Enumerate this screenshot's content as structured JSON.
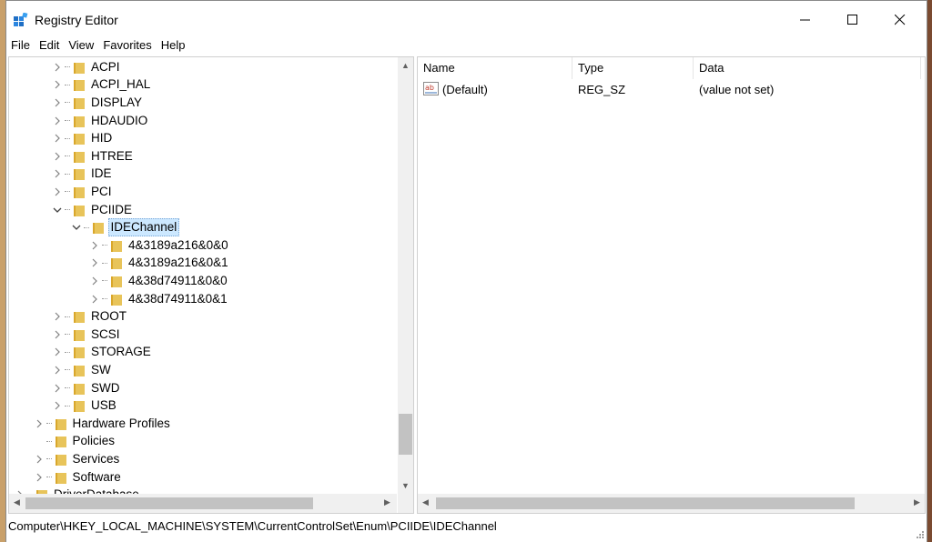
{
  "window": {
    "title": "Registry Editor",
    "controls": {
      "minimize": "—",
      "maximize": "☐",
      "close": "✕"
    }
  },
  "menu": [
    "File",
    "Edit",
    "View",
    "Favorites",
    "Help"
  ],
  "tree": {
    "nodes": [
      {
        "label": "ACPI",
        "depth": 4,
        "state": "collapsed"
      },
      {
        "label": "ACPI_HAL",
        "depth": 4,
        "state": "collapsed"
      },
      {
        "label": "DISPLAY",
        "depth": 4,
        "state": "collapsed"
      },
      {
        "label": "HDAUDIO",
        "depth": 4,
        "state": "collapsed"
      },
      {
        "label": "HID",
        "depth": 4,
        "state": "collapsed"
      },
      {
        "label": "HTREE",
        "depth": 4,
        "state": "collapsed"
      },
      {
        "label": "IDE",
        "depth": 4,
        "state": "collapsed"
      },
      {
        "label": "PCI",
        "depth": 4,
        "state": "collapsed"
      },
      {
        "label": "PCIIDE",
        "depth": 4,
        "state": "expanded"
      },
      {
        "label": "IDEChannel",
        "depth": 5,
        "state": "expanded",
        "selected": true
      },
      {
        "label": "4&3189a216&0&0",
        "depth": 6,
        "state": "collapsed"
      },
      {
        "label": "4&3189a216&0&1",
        "depth": 6,
        "state": "collapsed"
      },
      {
        "label": "4&38d74911&0&0",
        "depth": 6,
        "state": "collapsed"
      },
      {
        "label": "4&38d74911&0&1",
        "depth": 6,
        "state": "collapsed"
      },
      {
        "label": "ROOT",
        "depth": 4,
        "state": "collapsed"
      },
      {
        "label": "SCSI",
        "depth": 4,
        "state": "collapsed"
      },
      {
        "label": "STORAGE",
        "depth": 4,
        "state": "collapsed"
      },
      {
        "label": "SW",
        "depth": 4,
        "state": "collapsed"
      },
      {
        "label": "SWD",
        "depth": 4,
        "state": "collapsed"
      },
      {
        "label": "USB",
        "depth": 4,
        "state": "collapsed"
      },
      {
        "label": "Hardware Profiles",
        "depth": 3,
        "state": "collapsed"
      },
      {
        "label": "Policies",
        "depth": 3,
        "state": "leaf"
      },
      {
        "label": "Services",
        "depth": 3,
        "state": "collapsed"
      },
      {
        "label": "Software",
        "depth": 3,
        "state": "collapsed"
      },
      {
        "label": "DriverDatabase",
        "depth": 2,
        "state": "collapsed"
      }
    ]
  },
  "list": {
    "columns": [
      "Name",
      "Type",
      "Data"
    ],
    "rows": [
      {
        "name": "(Default)",
        "type": "REG_SZ",
        "data": "(value not set)",
        "icon": "string-value-icon"
      }
    ]
  },
  "statusbar": {
    "path": "Computer\\HKEY_LOCAL_MACHINE\\SYSTEM\\CurrentControlSet\\Enum\\PCIIDE\\IDEChannel"
  },
  "colors": {
    "selection": "#cce8ff",
    "folder": "#e8c45a",
    "scrollbar_track": "#f0f0f0",
    "scrollbar_thumb": "#c2c2c2"
  }
}
